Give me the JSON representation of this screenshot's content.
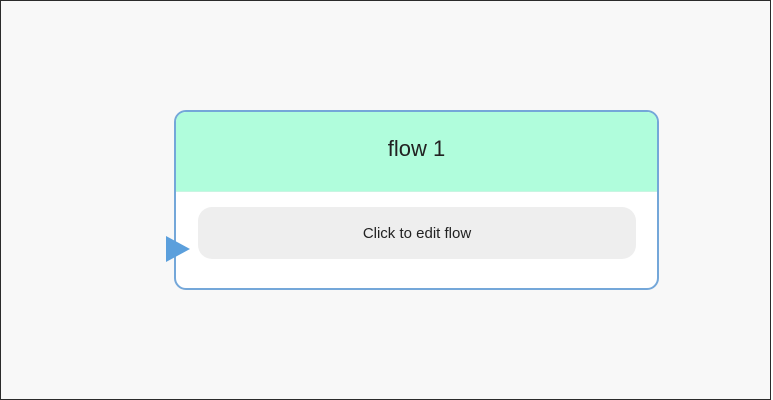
{
  "flow_node": {
    "title": "flow 1",
    "edit_label": "Click to edit flow"
  },
  "colors": {
    "canvas_background": "#f8f8f8",
    "node_border": "#74a7d9",
    "header_background": "#b0fddc",
    "edit_button_background": "#eeeeee",
    "port_color": "#5b9fdc"
  },
  "icons": {
    "input_port": "triangle-right-icon"
  }
}
